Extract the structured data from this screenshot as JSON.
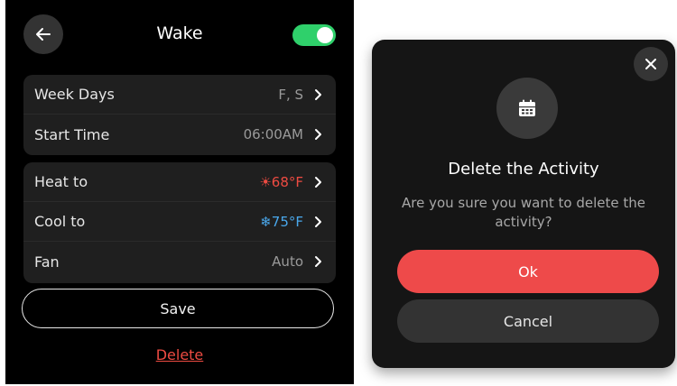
{
  "schedule": {
    "title": "Wake",
    "enabled": true,
    "rows_primary": [
      {
        "label": "Week Days",
        "value": "F, S"
      },
      {
        "label": "Start Time",
        "value": "06:00AM"
      }
    ],
    "rows_climate": [
      {
        "label": "Heat to",
        "value": "68°F",
        "icon": "sun-icon"
      },
      {
        "label": "Cool to",
        "value": "75°F",
        "icon": "snowflake-icon"
      },
      {
        "label": "Fan",
        "value": "Auto"
      }
    ],
    "save_label": "Save",
    "delete_label": "Delete"
  },
  "dialog": {
    "title": "Delete the Activity",
    "message": "Are you sure you want to delete the activity?",
    "ok_label": "Ok",
    "cancel_label": "Cancel"
  },
  "colors": {
    "accent_toggle": "#2fd06b",
    "danger": "#ee4a4a",
    "heat": "#ee4b42",
    "cool": "#4aa8ec"
  }
}
